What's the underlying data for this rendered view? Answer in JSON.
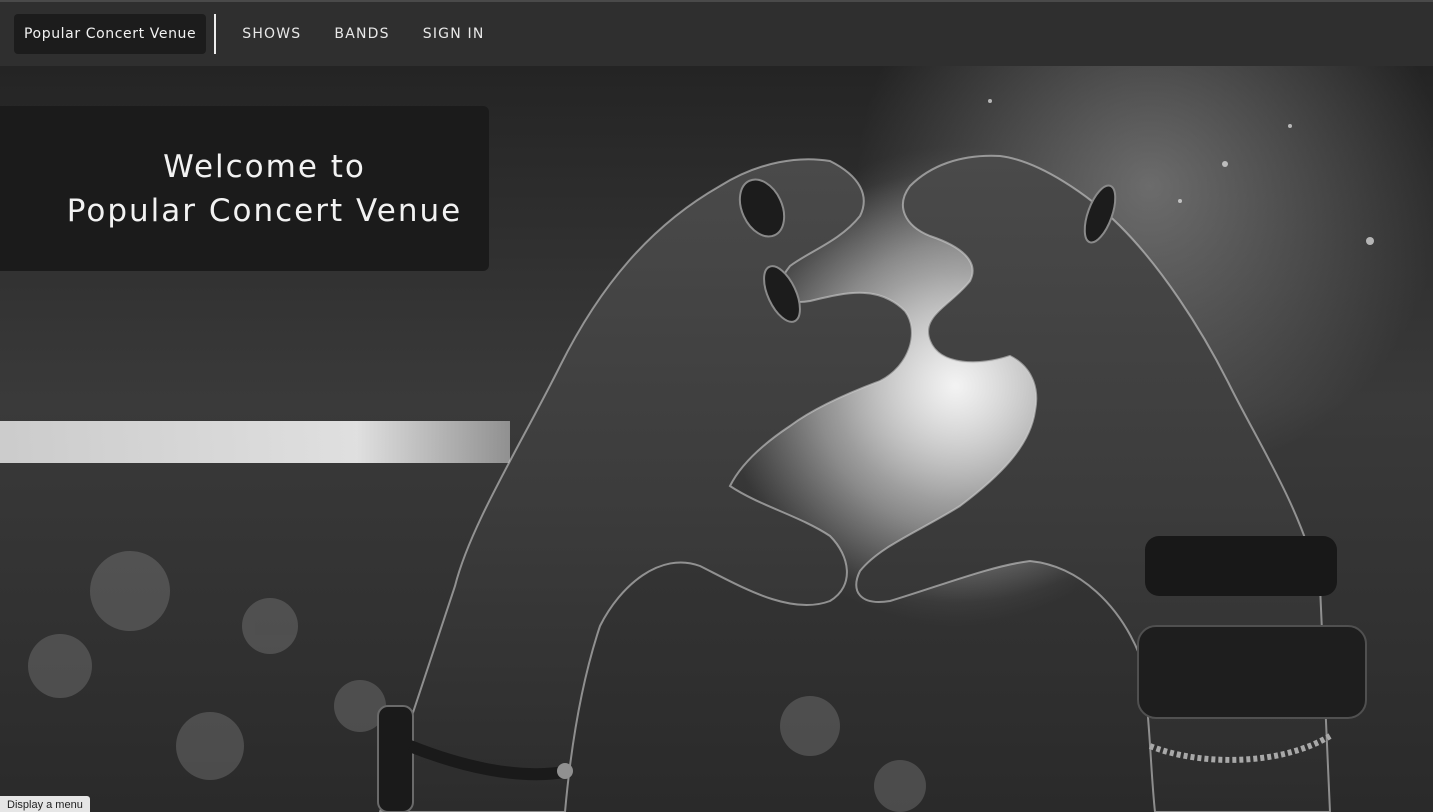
{
  "navbar": {
    "brand_label": "Popular Concert Venue",
    "links": [
      {
        "label": "SHOWS"
      },
      {
        "label": "BANDS"
      },
      {
        "label": "SIGN IN"
      }
    ]
  },
  "hero": {
    "welcome_line_1": "Welcome to",
    "welcome_line_2": "Popular Concert Venue",
    "image_description_icon": "heart-hands-photo"
  },
  "tooltip": {
    "text": "Display a menu"
  },
  "colors": {
    "navbar_bg": "#2f2f2f",
    "brand_bg": "#1c1c1c",
    "card_bg": "#1b1b1b",
    "text": "#f2f2f2"
  }
}
